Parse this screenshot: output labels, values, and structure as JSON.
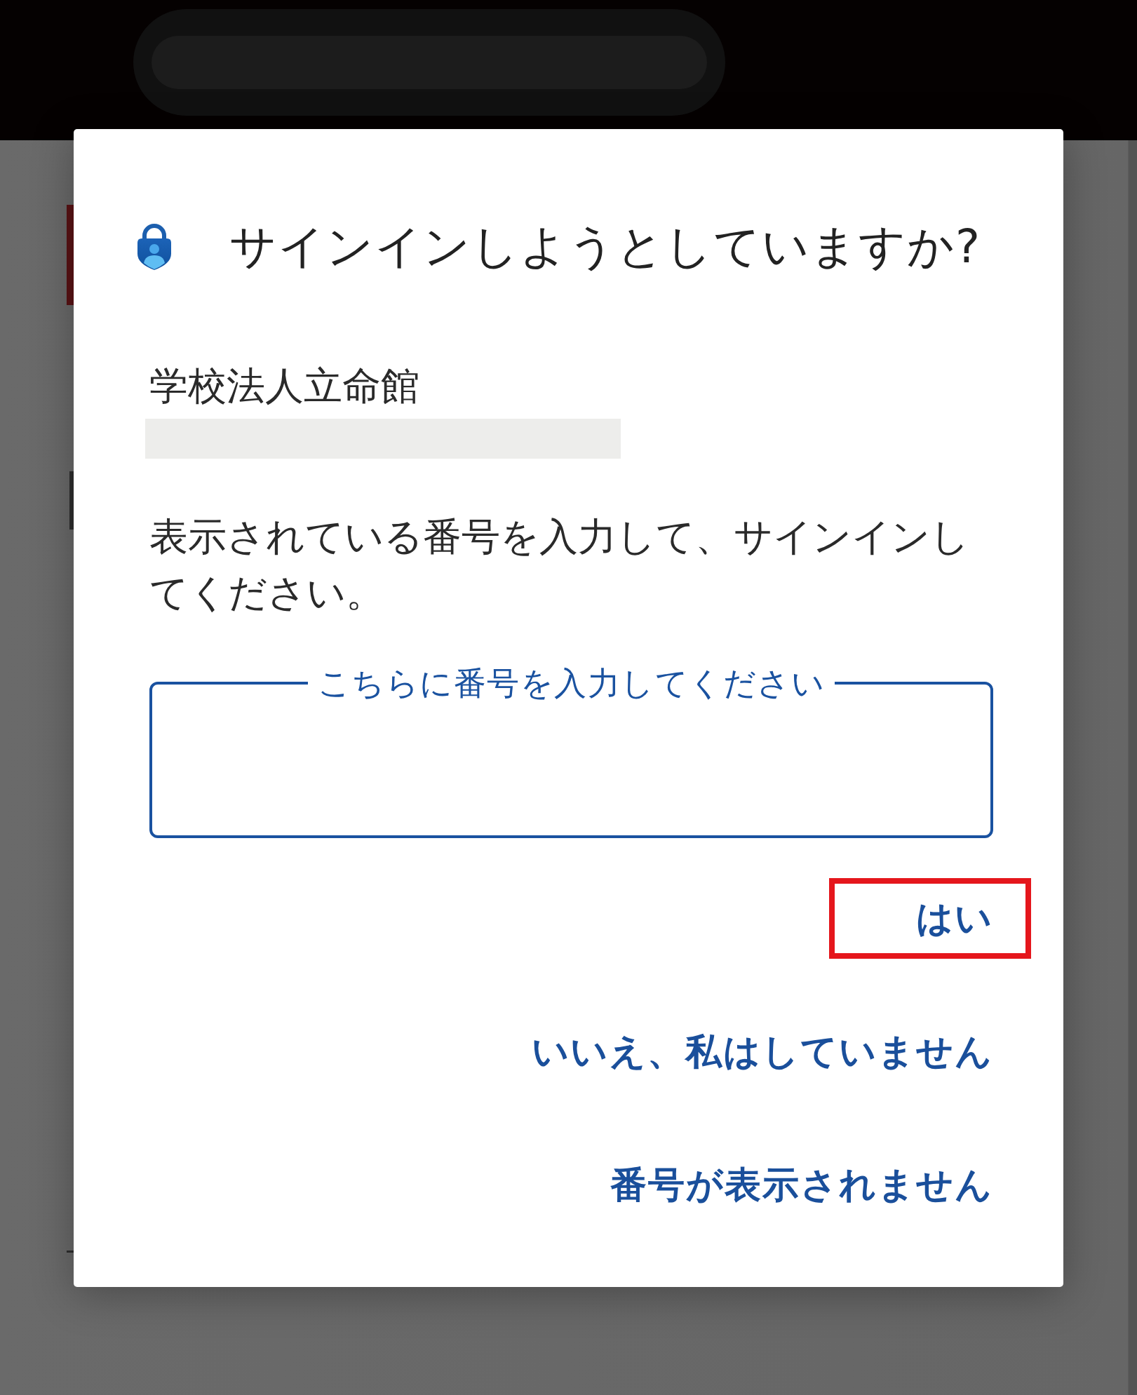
{
  "dialog": {
    "title": "サインインしようとしていますか?",
    "organization": "学校法人立命館",
    "account_redacted": true,
    "message": "表示されている番号を入力して、サインインしてください。",
    "number_field": {
      "label": "こちらに番号を入力してください"
    },
    "buttons": [
      {
        "label": "はい",
        "highlighted": true
      },
      {
        "label": "いいえ、私はしていません",
        "highlighted": false
      },
      {
        "label": "番号が表示されません",
        "highlighted": false
      }
    ]
  }
}
